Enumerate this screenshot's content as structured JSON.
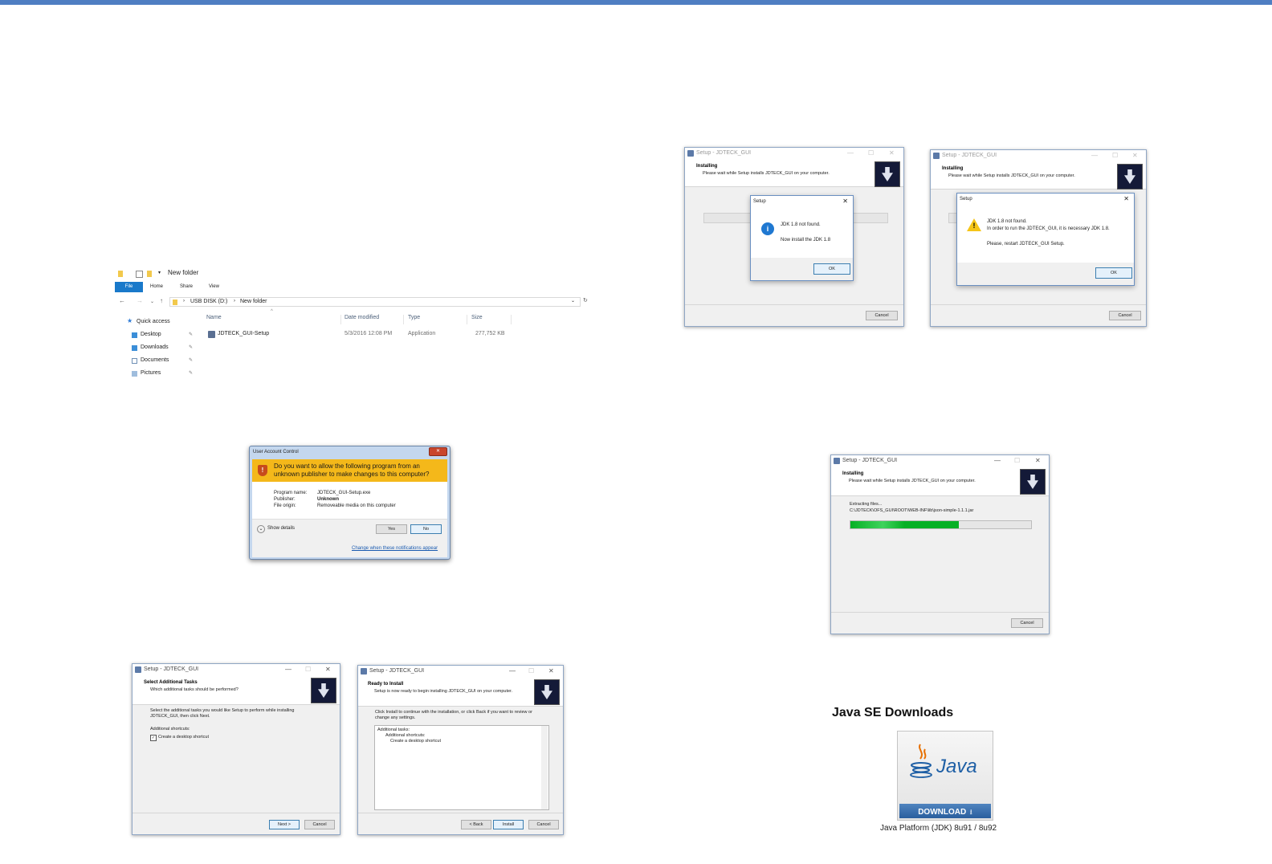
{
  "explorer": {
    "title": "New folder",
    "tabs": [
      "File",
      "Home",
      "Share",
      "View"
    ],
    "path": [
      "USB DISK (D:)",
      "New folder"
    ],
    "columns": {
      "name": "Name",
      "date": "Date modified",
      "type": "Type",
      "size": "Size"
    },
    "nav": [
      "Quick access",
      "Desktop",
      "Downloads",
      "Documents",
      "Pictures"
    ],
    "file": {
      "name": "JDTECK_GUI-Setup",
      "date": "5/3/2016 12:08 PM",
      "type": "Application",
      "size": "277,752 KB"
    }
  },
  "uac": {
    "title": "User Account Control",
    "question": "Do you want to allow the following program from an unknown publisher to make changes to this computer?",
    "program_label": "Program name:",
    "program_value": "JDTECK_GUI-Setup.exe",
    "publisher_label": "Publisher:",
    "publisher_value": "Unknown",
    "origin_label": "File origin:",
    "origin_value": "Removeable media on this computer",
    "show_details": "Show details",
    "yes": "Yes",
    "no": "No",
    "link": "Change when these notifications appear"
  },
  "setup_title": "Setup - JDTECK_GUI",
  "tasks": {
    "heading": "Select Additional Tasks",
    "sub": "Which additional tasks should be performed?",
    "line1": "Select the additional tasks you would like Setup to perform while installing",
    "line2": "JDTECK_GUI, then click Next.",
    "shortcuts": "Additional shortcuts:",
    "checkbox": "Create a desktop shortcut",
    "next": "Next >",
    "cancel": "Cancel"
  },
  "ready": {
    "heading": "Ready to Install",
    "sub": "Setup is now ready to begin installing JDTECK_GUI on your computer.",
    "line1": "Click Install to continue with the installation, or click Back if you want to review or",
    "line2": "change any settings.",
    "box1": "Additional tasks:",
    "box2": "Additional shortcuts:",
    "box3": "Create a desktop shortcut",
    "back": "< Back",
    "install": "Install",
    "cancel": "Cancel"
  },
  "installing": {
    "heading": "Installing",
    "sub": "Please wait while Setup installs JDTECK_GUI on your computer.",
    "cancel": "Cancel"
  },
  "jdk_info": {
    "title": "Setup",
    "line1": "JDK 1.8 not found.",
    "line2": "Now install the JDK 1.8",
    "ok": "OK"
  },
  "jdk_warn": {
    "title": "Setup",
    "line1": "JDK 1.8 not found.",
    "line2": "In order to run the JDTECK_GUI, it is necessary JDK 1.8.",
    "line3": "Please, restart JDTECK_GUI Setup.",
    "ok": "OK"
  },
  "extract": {
    "label": "Extracting files...",
    "path": "C:\\JDTECK\\OFS_GUI\\ROOT\\WEB-INF\\lib\\json-simple-1.1.1.jar",
    "progress": 0.6
  },
  "java": {
    "heading": "Java SE Downloads",
    "logo": "Java",
    "download": "DOWNLOAD",
    "caption": "Java Platform (JDK) 8u91 / 8u92"
  },
  "colors": {
    "accent": "#4f7ec2",
    "uac_banner": "#f4b81a",
    "progress": "#06b025",
    "java_blue": "#1e5fa5"
  }
}
